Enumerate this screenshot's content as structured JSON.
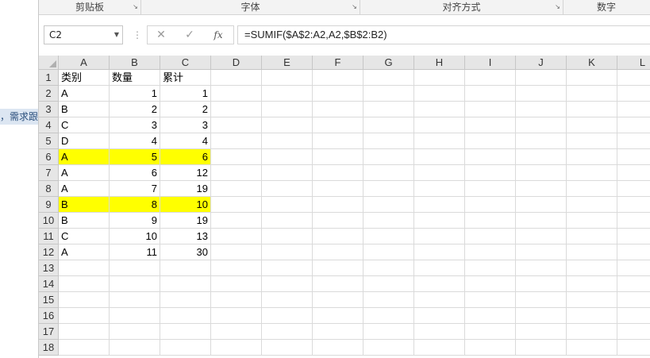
{
  "left_strip": {
    "highlight_text": "，需求跟"
  },
  "ribbon": {
    "groups": [
      {
        "label": "剪贴板",
        "launcher": "↘"
      },
      {
        "label": "字体",
        "launcher": "↘"
      },
      {
        "label": "对齐方式",
        "launcher": "↘"
      },
      {
        "label": "数字",
        "launcher": ""
      }
    ]
  },
  "formula_bar": {
    "name_box": "C2",
    "cancel_symbol": "✕",
    "enter_symbol": "✓",
    "fx_symbol": "fx",
    "formula": "=SUMIF($A$2:A2,A2,$B$2:B2)"
  },
  "columns": [
    "A",
    "B",
    "C",
    "D",
    "E",
    "F",
    "G",
    "H",
    "I",
    "J",
    "K",
    "L"
  ],
  "rows": [
    "1",
    "2",
    "3",
    "4",
    "5",
    "6",
    "7",
    "8",
    "9",
    "10",
    "11",
    "12",
    "13",
    "14",
    "15",
    "16",
    "17",
    "18"
  ],
  "table": {
    "headers": [
      "类别",
      "数量",
      "累计"
    ],
    "rows": [
      {
        "a": "A",
        "b": "1",
        "c": "1",
        "highlight": false
      },
      {
        "a": "B",
        "b": "2",
        "c": "2",
        "highlight": false
      },
      {
        "a": "C",
        "b": "3",
        "c": "3",
        "highlight": false
      },
      {
        "a": "D",
        "b": "4",
        "c": "4",
        "highlight": false
      },
      {
        "a": "A",
        "b": "5",
        "c": "6",
        "highlight": true
      },
      {
        "a": "A",
        "b": "6",
        "c": "12",
        "highlight": false
      },
      {
        "a": "A",
        "b": "7",
        "c": "19",
        "highlight": false
      },
      {
        "a": "B",
        "b": "8",
        "c": "10",
        "highlight": true
      },
      {
        "a": "B",
        "b": "9",
        "c": "19",
        "highlight": false
      },
      {
        "a": "C",
        "b": "10",
        "c": "13",
        "highlight": false
      },
      {
        "a": "A",
        "b": "11",
        "c": "30",
        "highlight": false
      }
    ]
  },
  "colors": {
    "highlight": "#ffff00",
    "header_bg": "#e6e6e6",
    "grid_line": "#dadada"
  }
}
